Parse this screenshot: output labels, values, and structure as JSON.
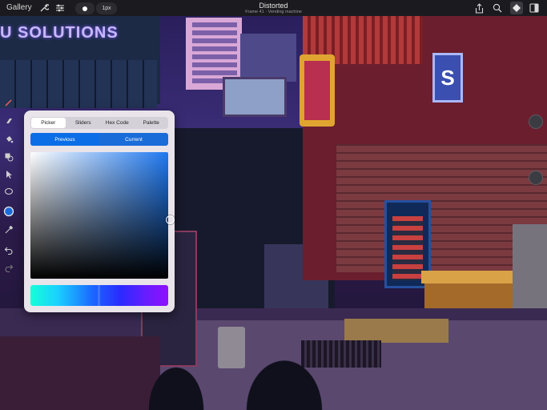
{
  "topbar": {
    "gallery_label": "Gallery",
    "brush_size_label": "1px",
    "document_title": "Distorted",
    "document_subtitle": "Frame 41 · Vending machine",
    "icons": [
      "wrench-icon",
      "adjustments-icon",
      "brush-icon",
      "share-icon",
      "zoom-icon",
      "layers-icon",
      "panels-icon"
    ]
  },
  "canvas": {
    "sign_text": "U SOLUTIONS",
    "small_sign": "S"
  },
  "left_toolbar": {
    "tools": [
      "pencil-icon",
      "eraser-icon",
      "bucket-icon",
      "shape-icon",
      "select-icon",
      "lasso-icon",
      "color-icon",
      "eyedropper-icon",
      "undo-icon",
      "redo-icon"
    ]
  },
  "color_picker": {
    "tabs": [
      "Picker",
      "Sliders",
      "Hex Code",
      "Palette"
    ],
    "active_tab": "Picker",
    "previous_label": "Previous",
    "current_label": "Current",
    "previous_color": "#0c6ee6",
    "current_color": "#1a6cd8",
    "hue_color": "#1e78f0"
  }
}
